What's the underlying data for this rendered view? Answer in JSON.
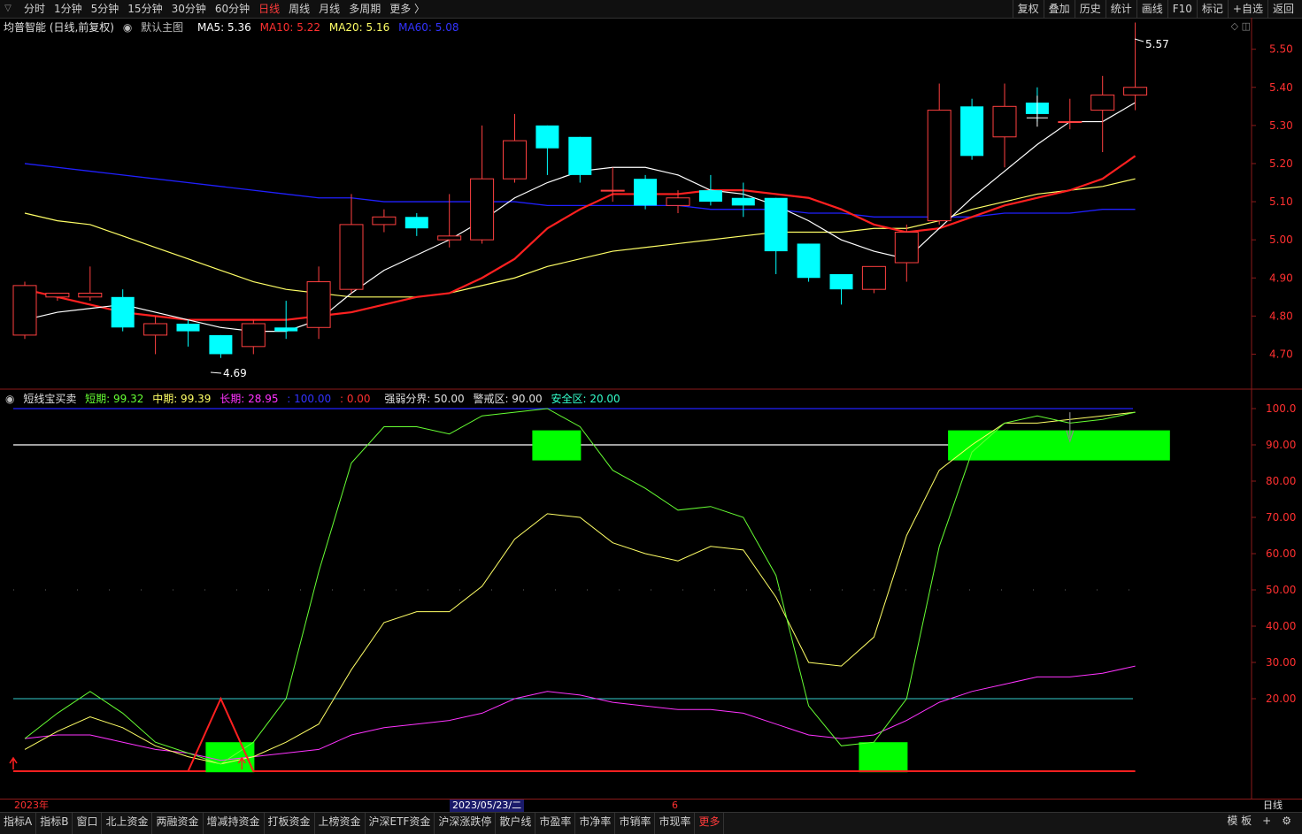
{
  "topbar": {
    "periods": [
      "分时",
      "1分钟",
      "5分钟",
      "15分钟",
      "30分钟",
      "60分钟",
      "日线",
      "周线",
      "月线",
      "多周期",
      "更多 〉"
    ],
    "active_period": "日线",
    "tools": [
      "复权",
      "叠加",
      "历史",
      "统计",
      "画线",
      "F10",
      "标记",
      "+自选",
      "返回"
    ]
  },
  "main_title": {
    "stock": "均普智能 (日线,前复权)",
    "template": "默认主图",
    "ma5": "MA5: 5.36",
    "ma10": "MA10: 5.22",
    "ma20": "MA20: 5.16",
    "ma60": "MA60: 5.08"
  },
  "indicator_title": {
    "name": "短线宝买卖",
    "short": "短期: 99.32",
    "mid": "中期: 99.39",
    "long": "长期: 28.95",
    "upper": ": 100.00",
    "lower": ": 0.00",
    "divide": "强弱分界: 50.00",
    "warn": "警戒区: 90.00",
    "safe": "安全区: 20.00"
  },
  "xaxis": {
    "year": "2023年",
    "cursor_date": "2023/05/23/二",
    "month": "6",
    "period_label": "日线"
  },
  "bottom_tabs": [
    "指标A",
    "指标B",
    "窗口",
    "北上资金",
    "两融资金",
    "增减持资金",
    "打板资金",
    "上榜资金",
    "沪深ETF资金",
    "沪深涨跌停",
    "散户线",
    "市盈率",
    "市净率",
    "市销率",
    "市现率",
    "更多"
  ],
  "bottom_right": [
    "模 板",
    "+",
    "⚙"
  ],
  "colors": {
    "up": "#ff4040",
    "down": "#00ffff",
    "ma5": "#ffffff",
    "ma10": "#ff2020",
    "ma20": "#ffff66",
    "ma60": "#2020ff",
    "short": "#66ff33",
    "mid": "#ffff66",
    "long": "#ff33ff",
    "signal": "#00ff00"
  },
  "chart_data": {
    "type": "candlestick",
    "price_axis": {
      "min": 4.65,
      "max": 5.6,
      "ticks": [
        "5.50",
        "5.40",
        "5.30",
        "5.20",
        "5.10",
        "5.00",
        "4.90",
        "4.80",
        "4.70"
      ]
    },
    "high_label": "5.57",
    "low_label": "4.69",
    "candles": [
      {
        "o": 4.75,
        "h": 4.89,
        "l": 4.74,
        "c": 4.88
      },
      {
        "o": 4.85,
        "h": 4.86,
        "l": 4.84,
        "c": 4.86
      },
      {
        "o": 4.85,
        "h": 4.93,
        "l": 4.84,
        "c": 4.86
      },
      {
        "o": 4.85,
        "h": 4.87,
        "l": 4.76,
        "c": 4.77
      },
      {
        "o": 4.75,
        "h": 4.8,
        "l": 4.7,
        "c": 4.78
      },
      {
        "o": 4.78,
        "h": 4.79,
        "l": 4.72,
        "c": 4.76
      },
      {
        "o": 4.75,
        "h": 4.75,
        "l": 4.69,
        "c": 4.7
      },
      {
        "o": 4.72,
        "h": 4.79,
        "l": 4.7,
        "c": 4.78
      },
      {
        "o": 4.77,
        "h": 4.84,
        "l": 4.74,
        "c": 4.76
      },
      {
        "o": 4.77,
        "h": 4.93,
        "l": 4.74,
        "c": 4.89
      },
      {
        "o": 4.87,
        "h": 5.12,
        "l": 4.86,
        "c": 5.04
      },
      {
        "o": 5.04,
        "h": 5.08,
        "l": 5.02,
        "c": 5.06
      },
      {
        "o": 5.06,
        "h": 5.07,
        "l": 5.01,
        "c": 5.03
      },
      {
        "o": 5.0,
        "h": 5.12,
        "l": 4.98,
        "c": 5.01
      },
      {
        "o": 5.0,
        "h": 5.3,
        "l": 4.99,
        "c": 5.16
      },
      {
        "o": 5.16,
        "h": 5.33,
        "l": 5.15,
        "c": 5.26
      },
      {
        "o": 5.3,
        "h": 5.3,
        "l": 5.17,
        "c": 5.24
      },
      {
        "o": 5.27,
        "h": 5.27,
        "l": 5.15,
        "c": 5.17
      },
      {
        "o": 5.13,
        "h": 5.19,
        "l": 5.1,
        "c": 5.13
      },
      {
        "o": 5.16,
        "h": 5.17,
        "l": 5.08,
        "c": 5.09
      },
      {
        "o": 5.09,
        "h": 5.13,
        "l": 5.07,
        "c": 5.11
      },
      {
        "o": 5.13,
        "h": 5.17,
        "l": 5.09,
        "c": 5.1
      },
      {
        "o": 5.11,
        "h": 5.15,
        "l": 5.06,
        "c": 5.09
      },
      {
        "o": 5.11,
        "h": 5.11,
        "l": 4.91,
        "c": 4.97
      },
      {
        "o": 4.99,
        "h": 4.99,
        "l": 4.89,
        "c": 4.9
      },
      {
        "o": 4.91,
        "h": 4.91,
        "l": 4.83,
        "c": 4.87
      },
      {
        "o": 4.87,
        "h": 4.93,
        "l": 4.86,
        "c": 4.93
      },
      {
        "o": 4.94,
        "h": 5.04,
        "l": 4.89,
        "c": 5.02
      },
      {
        "o": 5.05,
        "h": 5.41,
        "l": 5.04,
        "c": 5.34
      },
      {
        "o": 5.35,
        "h": 5.37,
        "l": 5.21,
        "c": 5.22
      },
      {
        "o": 5.27,
        "h": 5.41,
        "l": 5.19,
        "c": 5.35
      },
      {
        "o": 5.36,
        "h": 5.4,
        "l": 5.31,
        "c": 5.33
      },
      {
        "o": 5.31,
        "h": 5.37,
        "l": 5.29,
        "c": 5.31
      },
      {
        "o": 5.34,
        "h": 5.43,
        "l": 5.23,
        "c": 5.38
      },
      {
        "o": 5.38,
        "h": 5.57,
        "l": 5.34,
        "c": 5.4
      }
    ],
    "ma5": [
      4.79,
      4.81,
      4.82,
      4.83,
      4.81,
      4.79,
      4.77,
      4.76,
      4.76,
      4.79,
      4.86,
      4.92,
      4.96,
      5.0,
      5.05,
      5.11,
      5.15,
      5.18,
      5.19,
      5.19,
      5.17,
      5.13,
      5.12,
      5.09,
      5.05,
      5.0,
      4.97,
      4.95,
      5.03,
      5.11,
      5.18,
      5.25,
      5.31,
      5.31,
      5.36
    ],
    "ma10": [
      4.87,
      4.85,
      4.83,
      4.81,
      4.8,
      4.79,
      4.79,
      4.79,
      4.79,
      4.8,
      4.81,
      4.83,
      4.85,
      4.86,
      4.9,
      4.95,
      5.03,
      5.08,
      5.12,
      5.12,
      5.12,
      5.13,
      5.13,
      5.12,
      5.11,
      5.08,
      5.04,
      5.02,
      5.03,
      5.06,
      5.09,
      5.11,
      5.13,
      5.16,
      5.22
    ],
    "ma20": [
      5.07,
      5.05,
      5.04,
      5.01,
      4.98,
      4.95,
      4.92,
      4.89,
      4.87,
      4.86,
      4.85,
      4.85,
      4.85,
      4.86,
      4.88,
      4.9,
      4.93,
      4.95,
      4.97,
      4.98,
      4.99,
      5.0,
      5.01,
      5.02,
      5.02,
      5.02,
      5.03,
      5.03,
      5.05,
      5.08,
      5.1,
      5.12,
      5.13,
      5.14,
      5.16
    ],
    "ma60": [
      5.2,
      5.19,
      5.18,
      5.17,
      5.16,
      5.15,
      5.14,
      5.13,
      5.12,
      5.11,
      5.11,
      5.1,
      5.1,
      5.1,
      5.1,
      5.1,
      5.09,
      5.09,
      5.09,
      5.09,
      5.09,
      5.08,
      5.08,
      5.08,
      5.07,
      5.07,
      5.06,
      5.06,
      5.06,
      5.06,
      5.07,
      5.07,
      5.07,
      5.08,
      5.08
    ],
    "indicator": {
      "axis": {
        "min": 0,
        "max": 100,
        "ticks": [
          "100.0",
          "90.00",
          "80.00",
          "70.00",
          "60.00",
          "50.00",
          "40.00",
          "30.00",
          "20.00"
        ]
      },
      "short": [
        9,
        16,
        22,
        16,
        8,
        5,
        2,
        8,
        20,
        55,
        85,
        95,
        95,
        93,
        98,
        99,
        100,
        95,
        83,
        78,
        72,
        73,
        70,
        54,
        18,
        7,
        8,
        20,
        62,
        88,
        96,
        98,
        96,
        97,
        99
      ],
      "mid": [
        6,
        11,
        15,
        12,
        7,
        4,
        2,
        4,
        8,
        13,
        28,
        41,
        44,
        44,
        51,
        64,
        71,
        70,
        63,
        60,
        58,
        62,
        61,
        48,
        30,
        29,
        37,
        65,
        83,
        90,
        96,
        96,
        97,
        98,
        99
      ],
      "long": [
        9,
        10,
        10,
        8,
        6,
        5,
        3,
        4,
        5,
        6,
        10,
        12,
        13,
        14,
        16,
        20,
        22,
        21,
        19,
        18,
        17,
        17,
        16,
        13,
        10,
        9,
        10,
        14,
        19,
        22,
        24,
        26,
        26,
        27,
        29
      ],
      "risk_line": [
        0,
        0,
        0,
        0,
        0,
        0,
        20,
        0,
        0,
        0,
        0,
        0,
        0,
        0,
        0,
        0,
        0,
        0,
        0,
        0,
        0,
        0,
        0,
        0,
        0,
        0,
        0,
        0,
        0,
        0,
        0,
        0,
        0,
        0,
        0
      ],
      "buy_signals": [
        6,
        26
      ],
      "sell_signals": [
        16
      ],
      "sell_zone": [
        29,
        32
      ],
      "up_arrows": [
        0,
        7
      ],
      "down_arrow": 32
    }
  }
}
